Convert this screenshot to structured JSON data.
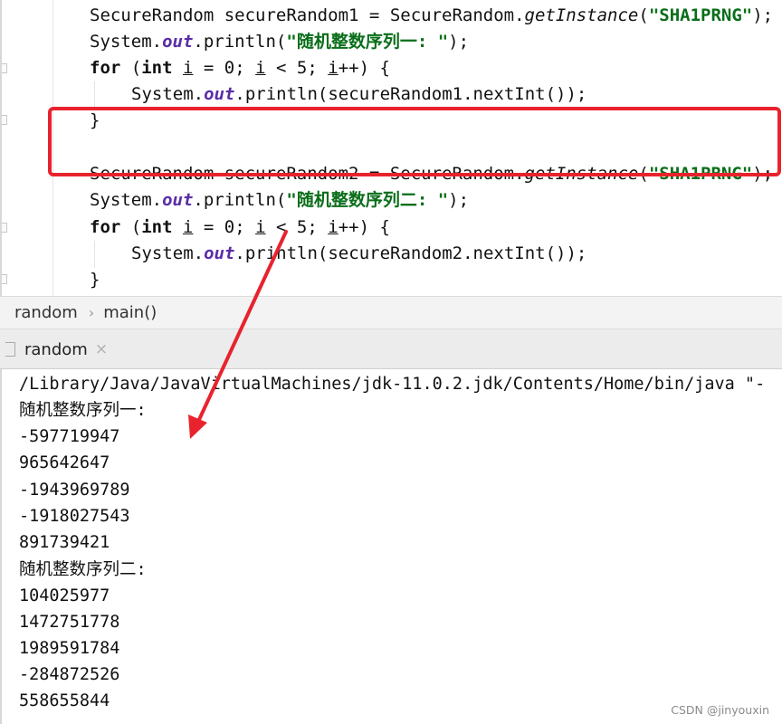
{
  "editor": {
    "lines": {
      "l1": {
        "type": "SecureRandom",
        "var": "secureRandom1",
        "eq": "=",
        "cls": "SecureRandom",
        "dot": ".",
        "method": "getInstance",
        "open": "(",
        "str": "\"SHA1PRNG\"",
        "close": ");"
      },
      "l2": {
        "sys": "System",
        "dot1": ".",
        "out": "out",
        "rest": ".println(",
        "str": "\"随机整数序列一: \"",
        "close": ");"
      },
      "l3": {
        "kw_for": "for",
        "p1": " (",
        "kw_int": "int",
        "sp": " ",
        "i1": "i",
        "eq0": " = ",
        "n0": "0",
        "semi1": "; ",
        "i2": "i",
        "lt": " < ",
        "n5": "5",
        "semi2": "; ",
        "i3": "i",
        "inc": "++) {"
      },
      "l4": {
        "sys": "System",
        "dot1": ".",
        "out": "out",
        "rest": ".println(secureRandom1.nextInt());"
      },
      "l5": {
        "brace": "}"
      },
      "l6": {
        "type": "SecureRandom",
        "var": "secureRandom2",
        "eq": "=",
        "cls": "SecureRandom",
        "dot": ".",
        "method": "getInstance",
        "open": "(",
        "str": "\"SHA1PRNG\"",
        "close": ");"
      },
      "l7": {
        "sys": "System",
        "dot1": ".",
        "out": "out",
        "rest": ".println(",
        "str": "\"随机整数序列二: \"",
        "close": ");"
      },
      "l8": {
        "kw_for": "for",
        "p1": " (",
        "kw_int": "int",
        "sp": " ",
        "i1": "i",
        "eq0": " = ",
        "n0": "0",
        "semi1": "; ",
        "i2": "i",
        "lt": " < ",
        "n5": "5",
        "semi2": "; ",
        "i3": "i",
        "inc": "++) {"
      },
      "l9": {
        "sys": "System",
        "dot1": ".",
        "out": "out",
        "rest": ".println(secureRandom2.nextInt());"
      },
      "l10": {
        "brace": "}"
      }
    }
  },
  "breadcrumb": {
    "items": [
      "random",
      "main()"
    ],
    "separator": "›"
  },
  "run_panel": {
    "tab_label": "random",
    "close_glyph": "×"
  },
  "console": {
    "lines": [
      "/Library/Java/JavaVirtualMachines/jdk-11.0.2.jdk/Contents/Home/bin/java \"-",
      "随机整数序列一:",
      "-597719947",
      "965642647",
      "-1943969789",
      "-1918027543",
      "891739421",
      "随机整数序列二:",
      "104025977",
      "1472751778",
      "1989591784",
      "-284872526",
      "558655844"
    ]
  },
  "watermark": "CSDN @jinyouxin",
  "colors": {
    "annotation": "#e8232d",
    "keyword": "#000080",
    "string": "#0a6e1a",
    "number": "#1750eb",
    "static_field": "#5a2ea6"
  }
}
